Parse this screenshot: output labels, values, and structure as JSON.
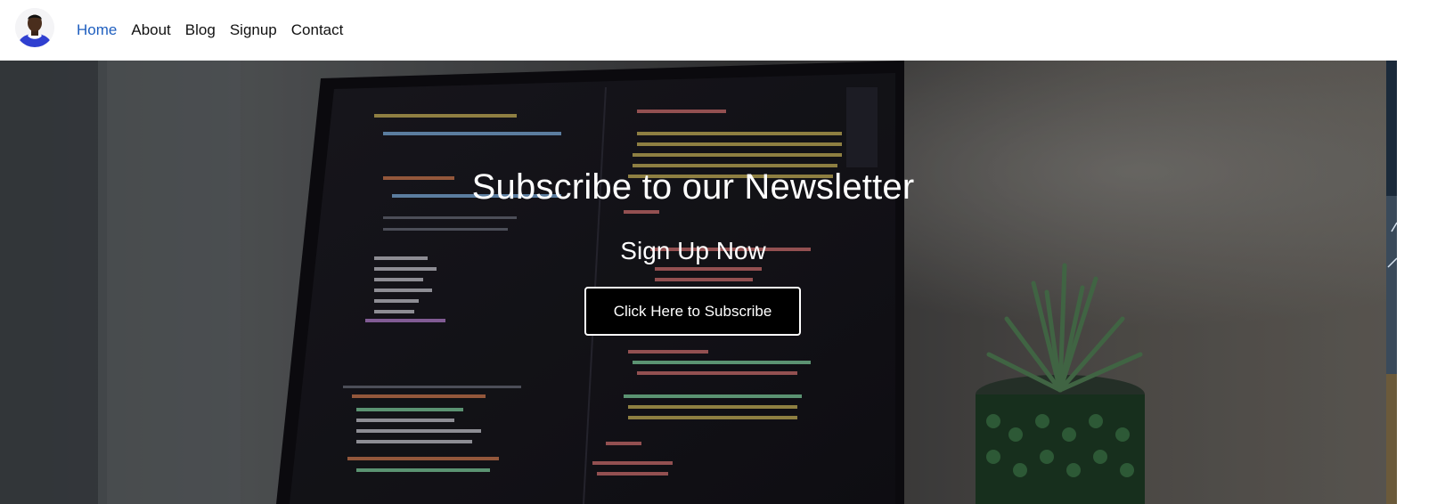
{
  "nav": {
    "links": [
      {
        "label": "Home",
        "active": true
      },
      {
        "label": "About",
        "active": false
      },
      {
        "label": "Blog",
        "active": false
      },
      {
        "label": "Signup",
        "active": false
      },
      {
        "label": "Contact",
        "active": false
      }
    ]
  },
  "hero": {
    "title": "Subscribe to our Newsletter",
    "subtitle": "Sign Up Now",
    "button_label": "Click Here to Subscribe"
  },
  "colors": {
    "nav_active": "#1f5fbf",
    "nav_text": "#111111",
    "button_bg": "#000000",
    "button_border": "#ffffff"
  },
  "icons": {
    "logo": "avatar-logo-icon"
  }
}
